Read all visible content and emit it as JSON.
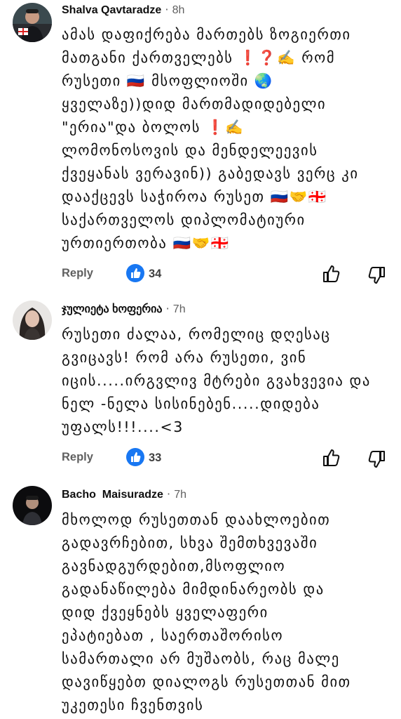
{
  "comments": [
    {
      "author": "Shalva Qavtaradze",
      "separator": "·",
      "time": "8h",
      "lines": [
        "ამას დაფიქრება მართებს ზოგიერთი",
        "მათგანი ქართველებს ❗❓✍️ რომ",
        "რუსეთი 🇷🇺 მსოფლიოში 🌏",
        "ყველაზე))დიდ მართმადიდებელი",
        "\"ერია\"და ბოლოს ❗✍️",
        "ლომონოსოვის და მენდელეევის",
        "ქვეყანას ვერავინ)) გაბედავს ვერც კი",
        "დააქცევს საჭიროა რუსეთ 🇷🇺🤝🇬🇪",
        "საქართველოს დიპლომატიური",
        "ურთიერთობა 🇷🇺🤝🇬🇪"
      ],
      "reply_label": "Reply",
      "likes": "34"
    },
    {
      "author": "ჯულიეტა ხოფერია",
      "separator": "·",
      "time": "7h",
      "lines": [
        "რუსეთი ძალაა, რომელიც დღესაც",
        "გვიცავს! რომ არა რუსეთი, ვინ",
        "იცის.....ირგვლივ მტრები გვახვევია და",
        "ნელ -ნელა სისინებენ.....დიდება",
        "უფალს!!!....<3"
      ],
      "reply_label": "Reply",
      "likes": "33"
    },
    {
      "author": "Bacho  Maisuradze",
      "separator": "·",
      "time": "7h",
      "lines": [
        "მხოლოდ რუსეთთან დაახლოებით",
        "გადავრჩებით, სხვა შემთხვევაში",
        "გავნადგურდებით,მსოფლიო",
        "გადანაწილება მიმდინარეობს და",
        "დიდ ქვეყნებს ყველაფერი",
        "ეპატიებათ , საერთაშორისო",
        "სამართალი არ მუშაობს, რაც მალე",
        "დავიწყებთ დიალოგს რუსეთთან მით",
        "უკეთესი ჩვენთვის"
      ]
    }
  ],
  "colors": {
    "text": "#0f0f0f",
    "muted": "#606060",
    "like_badge": "#1877f2"
  },
  "icons": [
    "like-badge-icon",
    "thumbs-up-icon",
    "thumbs-down-icon",
    "russia-flag-icon",
    "georgia-flag-icon",
    "handshake-icon",
    "globe-icon",
    "exclamation-icon",
    "question-icon",
    "writing-hand-icon"
  ]
}
